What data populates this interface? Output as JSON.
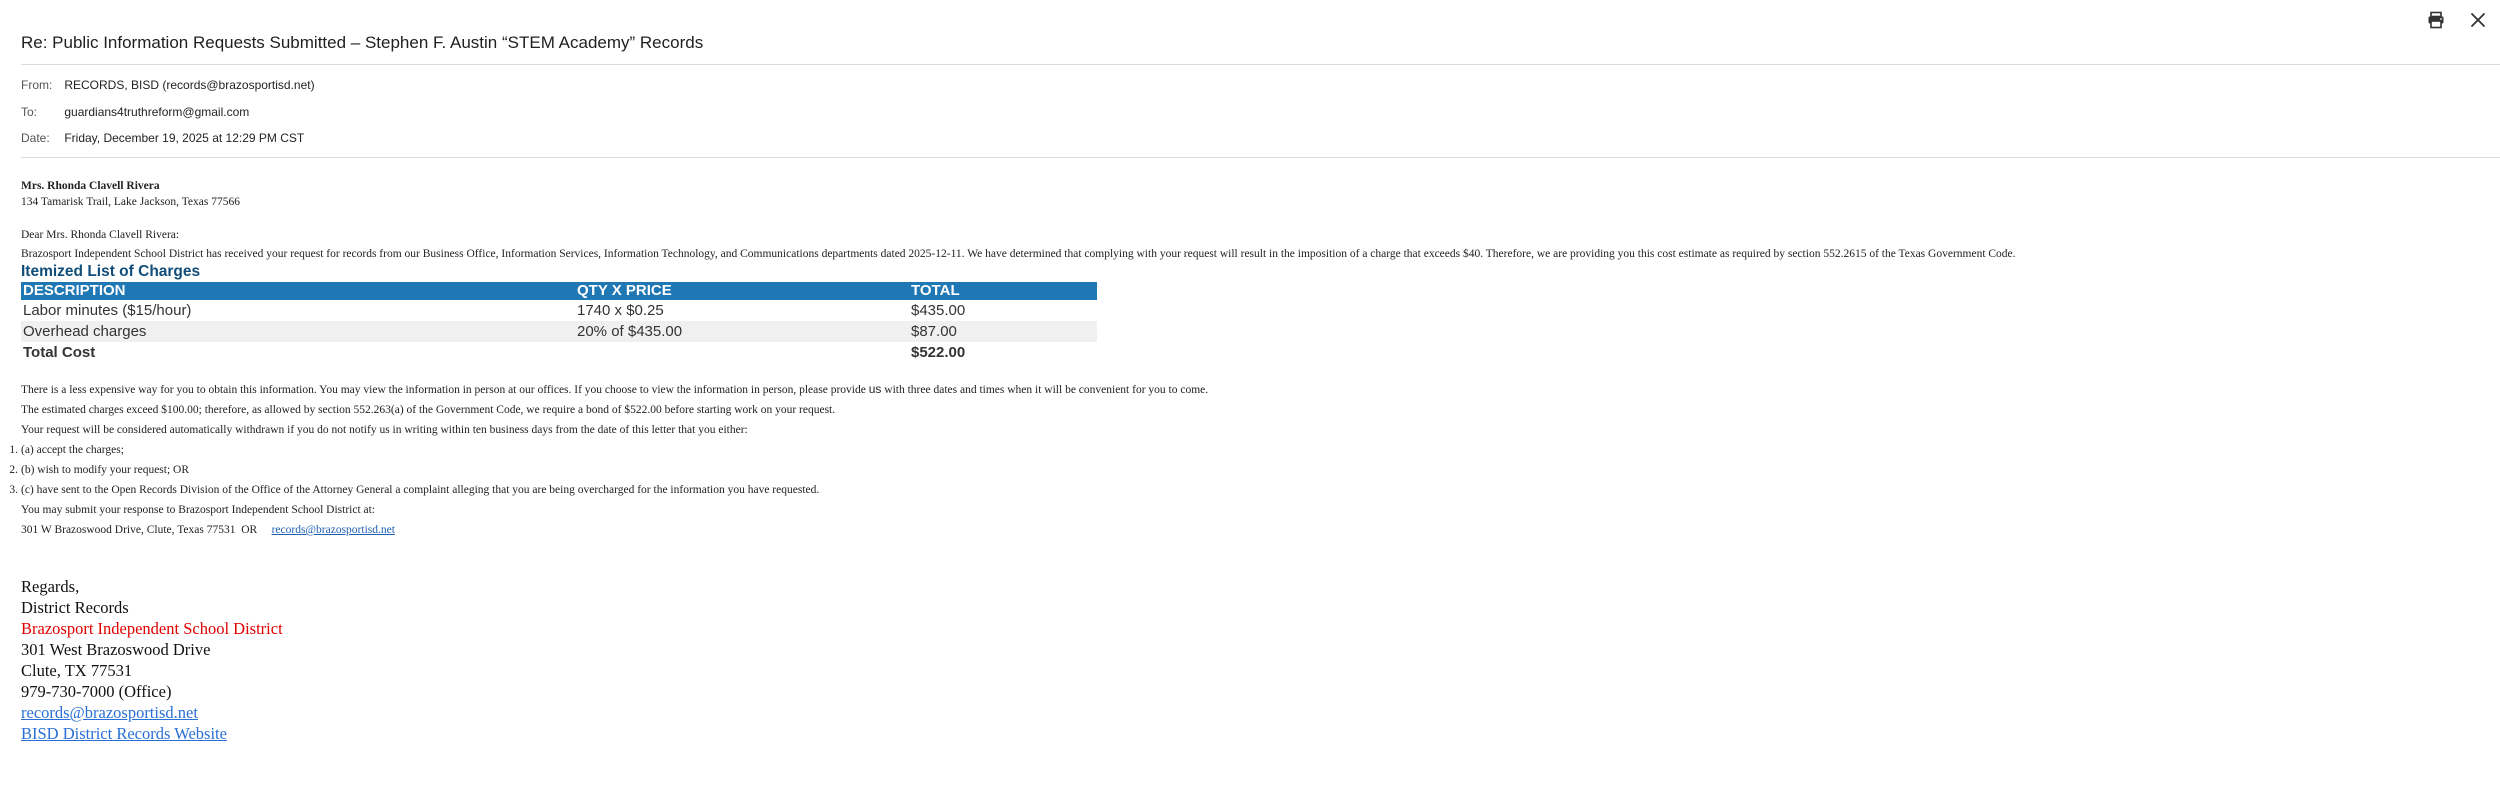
{
  "header": {
    "subject": "Re: Public Information Requests Submitted – Stephen F. Austin “STEM Academy” Records",
    "from_label": "From:",
    "from_value": "RECORDS, BISD (records@brazosportisd.net)",
    "to_label": "To:",
    "to_value": "guardians4truthreform@gmail.com",
    "date_label": "Date:",
    "date_value": "Friday, December 19, 2025 at 12:29 PM CST"
  },
  "icons": {
    "print": "printer-icon",
    "close": "close-icon"
  },
  "letter": {
    "recipient_name": "Mrs. Rhonda Clavell Rivera",
    "recipient_address": "134 Tamarisk Trail, Lake Jackson, Texas 77566",
    "greeting": "Dear Mrs. Rhonda Clavell Rivera:",
    "intro": "Brazosport Independent School District has received your request for records from our Business Office, Information Services, Information Technology, and Communications departments dated 2025-12-11. We have determined that complying with your request will result in the imposition of a charge that exceeds $40. Therefore, we are providing you this cost estimate as required by section 552.2615 of the Texas Government Code.",
    "itemized_title": "Itemized List of Charges",
    "table": {
      "headers": [
        "DESCRIPTION",
        "QTY X PRICE",
        "TOTAL"
      ],
      "rows": [
        [
          "Labor minutes ($15/hour)",
          "1740 x $0.25",
          "$435.00"
        ],
        [
          "Overhead charges",
          "20% of $435.00",
          "$87.00"
        ]
      ],
      "total_label": "Total Cost",
      "total_value": "$522.00"
    },
    "p1_a": "There is a less expensive way for you to obtain this information. You may view the information in person at our offices. If you choose to view the information in person, please provide ",
    "p1_us": "us",
    "p1_b": " with three dates and times when it will be convenient for you to come.",
    "p2": "The estimated charges exceed $100.00; therefore, as allowed by section 552.263(a) of the Government Code, we require a bond of $522.00 before starting work on your request.",
    "p3": "Your request will be considered automatically withdrawn if you do not notify us in writing within ten business days from the date of this letter that you either:",
    "options": [
      {
        "num": "1.",
        "text": "(a) accept the charges;"
      },
      {
        "num": "2.",
        "text": "(b) wish to modify your request; OR"
      },
      {
        "num": "3.",
        "text": "(c) have sent to the Open Records Division of the Office of the Attorney General a complaint alleging that you are being overcharged for the information you have requested."
      }
    ],
    "submit_intro": "You may submit your response to Brazosport Independent School District at:",
    "submit_address": "301 W Brazoswood Drive, Clute, Texas 77531",
    "submit_or": "OR",
    "submit_email": "records@brazosportisd.net"
  },
  "signature": {
    "regards": "Regards,",
    "dept": "District Records",
    "org": "Brazosport Independent School District",
    "street": "301 West Brazoswood Drive",
    "city": "Clute, TX 77531",
    "phone": "979-730-7000 (Office)",
    "email_link": "records@brazosportisd.net",
    "website_link": "BISD District Records Website"
  },
  "colors": {
    "table_header_bg": "#1f77b4",
    "title_blue": "#114d7a",
    "org_red": "#e00000",
    "link_blue": "#1f5fb6"
  }
}
